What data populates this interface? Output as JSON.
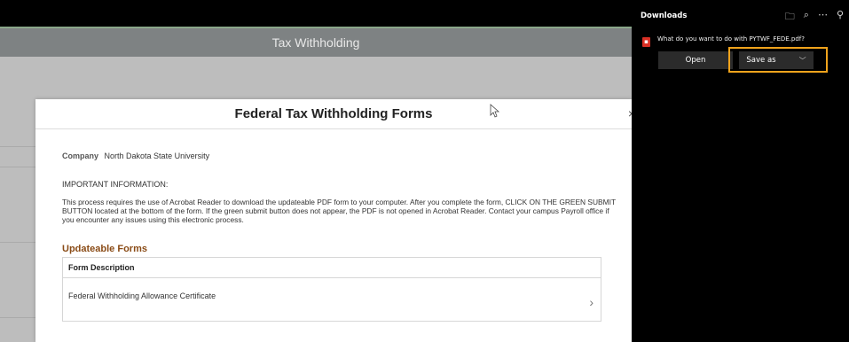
{
  "window": {
    "title": "Tax Withholding"
  },
  "modal": {
    "title": "Federal Tax Withholding Forms",
    "close_glyph": "×",
    "company_label": "Company",
    "company_value": "North Dakota State University",
    "important_heading": "IMPORTANT INFORMATION:",
    "paragraph": "This process requires the use of Acrobat Reader to download the updateable PDF form to your computer.  After you complete the form, CLICK ON THE GREEN SUBMIT BUTTON located at the bottom of the form.  If the green submit button does not appear, the PDF is not opened in Acrobat Reader. Contact your campus Payroll office if you encounter any issues using this electronic process.",
    "section_title": "Updateable Forms",
    "table_header": "Form Description",
    "forms": [
      {
        "label": "Federal Withholding Allowance Certificate",
        "chevron": "›"
      }
    ]
  },
  "downloads": {
    "title": "Downloads",
    "icons": {
      "folder": "folder-icon",
      "search": "search-icon",
      "more": "more-icon",
      "pin": "pin-icon"
    },
    "icon_glyphs": {
      "folder": "🗀",
      "search": "⌕",
      "more": "⋯",
      "pin": "⚲"
    },
    "prompt": "What do you want to do with PYTWF_FEDE.pdf?",
    "open_label": "Open",
    "save_as_label": "Save as",
    "save_as_chevron": "﹀",
    "highlight_color": "#f0a31c"
  }
}
